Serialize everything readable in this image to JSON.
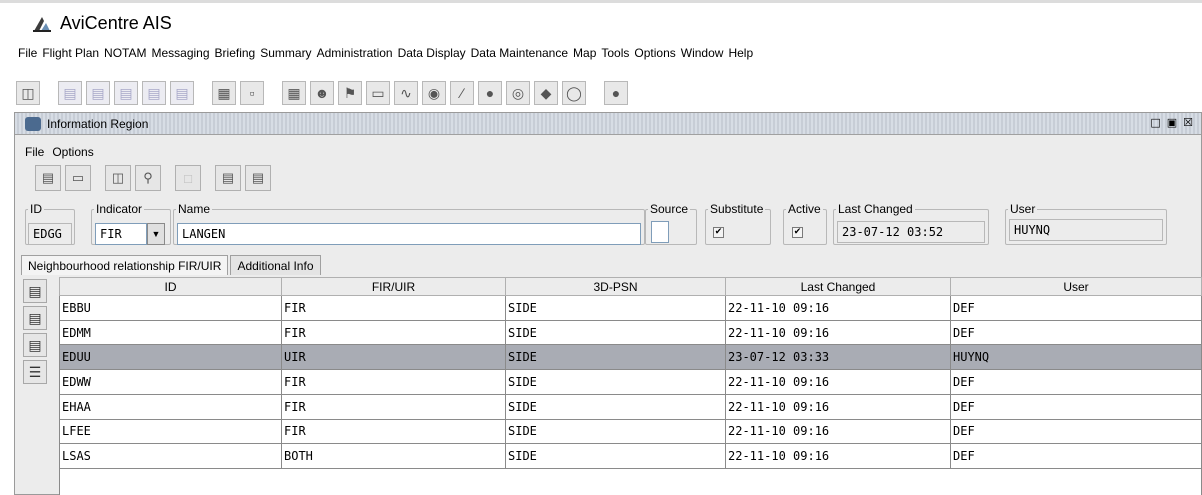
{
  "app": {
    "title": "AviCentre AIS"
  },
  "main_menu": [
    "File",
    "Flight Plan",
    "NOTAM",
    "Messaging",
    "Briefing",
    "Summary",
    "Administration",
    "Data Display",
    "Data Maintenance",
    "Map",
    "Tools",
    "Options",
    "Window",
    "Help"
  ],
  "window": {
    "title": "Information Region",
    "controls": [
      "restore-icon",
      "maximize-icon",
      "close-icon"
    ]
  },
  "inner_menu": [
    "File",
    "Options"
  ],
  "form": {
    "id_label": "ID",
    "id_value": "EDGG",
    "indicator_label": "Indicator",
    "indicator_value": "FIR",
    "name_label": "Name",
    "name_value": "LANGEN",
    "source_label": "Source",
    "source_checked": false,
    "substitute_label": "Substitute",
    "substitute_checked": true,
    "active_label": "Active",
    "active_checked": true,
    "last_changed_label": "Last Changed",
    "last_changed_value": "23-07-12 03:52",
    "user_label": "User",
    "user_value": "HUYNQ"
  },
  "tabs": [
    {
      "label": "Neighbourhood relationship FIR/UIR",
      "active": true
    },
    {
      "label": "Additional Info",
      "active": false
    }
  ],
  "table": {
    "columns": [
      "ID",
      "FIR/UIR",
      "3D-PSN",
      "Last Changed",
      "User"
    ],
    "rows": [
      [
        "EBBU",
        "FIR",
        "SIDE",
        "22-11-10 09:16",
        "DEF"
      ],
      [
        "EDMM",
        "FIR",
        "SIDE",
        "22-11-10 09:16",
        "DEF"
      ],
      [
        "EDUU",
        "UIR",
        "SIDE",
        "23-07-12 03:33",
        "HUYNQ"
      ],
      [
        "EDWW",
        "FIR",
        "SIDE",
        "22-11-10 09:16",
        "DEF"
      ],
      [
        "EHAA",
        "FIR",
        "SIDE",
        "22-11-10 09:16",
        "DEF"
      ],
      [
        "LFEE",
        "FIR",
        "SIDE",
        "22-11-10 09:16",
        "DEF"
      ],
      [
        "LSAS",
        "BOTH",
        "SIDE",
        "22-11-10 09:16",
        "DEF"
      ]
    ],
    "selected_row": 2
  },
  "colors": {
    "selected_row": "#a9acb4",
    "field_border": "#7f9db9",
    "window_bg": "#ececec"
  }
}
